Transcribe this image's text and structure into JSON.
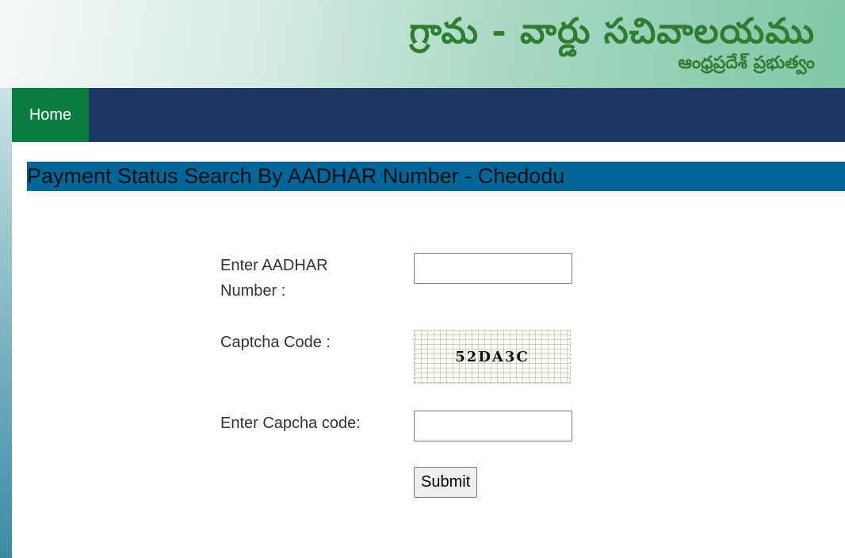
{
  "header": {
    "title": "గ్రామ - వార్డు సచివాలయము",
    "subtitle": "ఆంధ్రప్రదేశ్ ప్రభుత్వం"
  },
  "nav": {
    "home_label": "Home"
  },
  "page": {
    "heading": "Payment Status Search By AADHAR Number - Chedodu"
  },
  "form": {
    "aadhar_label_line1": "Enter AADHAR",
    "aadhar_label_line2": "Number :",
    "aadhar_value": "",
    "captcha_label": "Captcha Code :",
    "captcha_code": "52DA3C",
    "enter_captcha_label": "Enter Capcha code:",
    "captcha_input_value": "",
    "submit_label": "Submit"
  },
  "colors": {
    "nav_bg": "#1e3566",
    "home_bg": "#0b7d3e",
    "heading_bg": "#006699",
    "logo_text": "#2e7d32"
  }
}
